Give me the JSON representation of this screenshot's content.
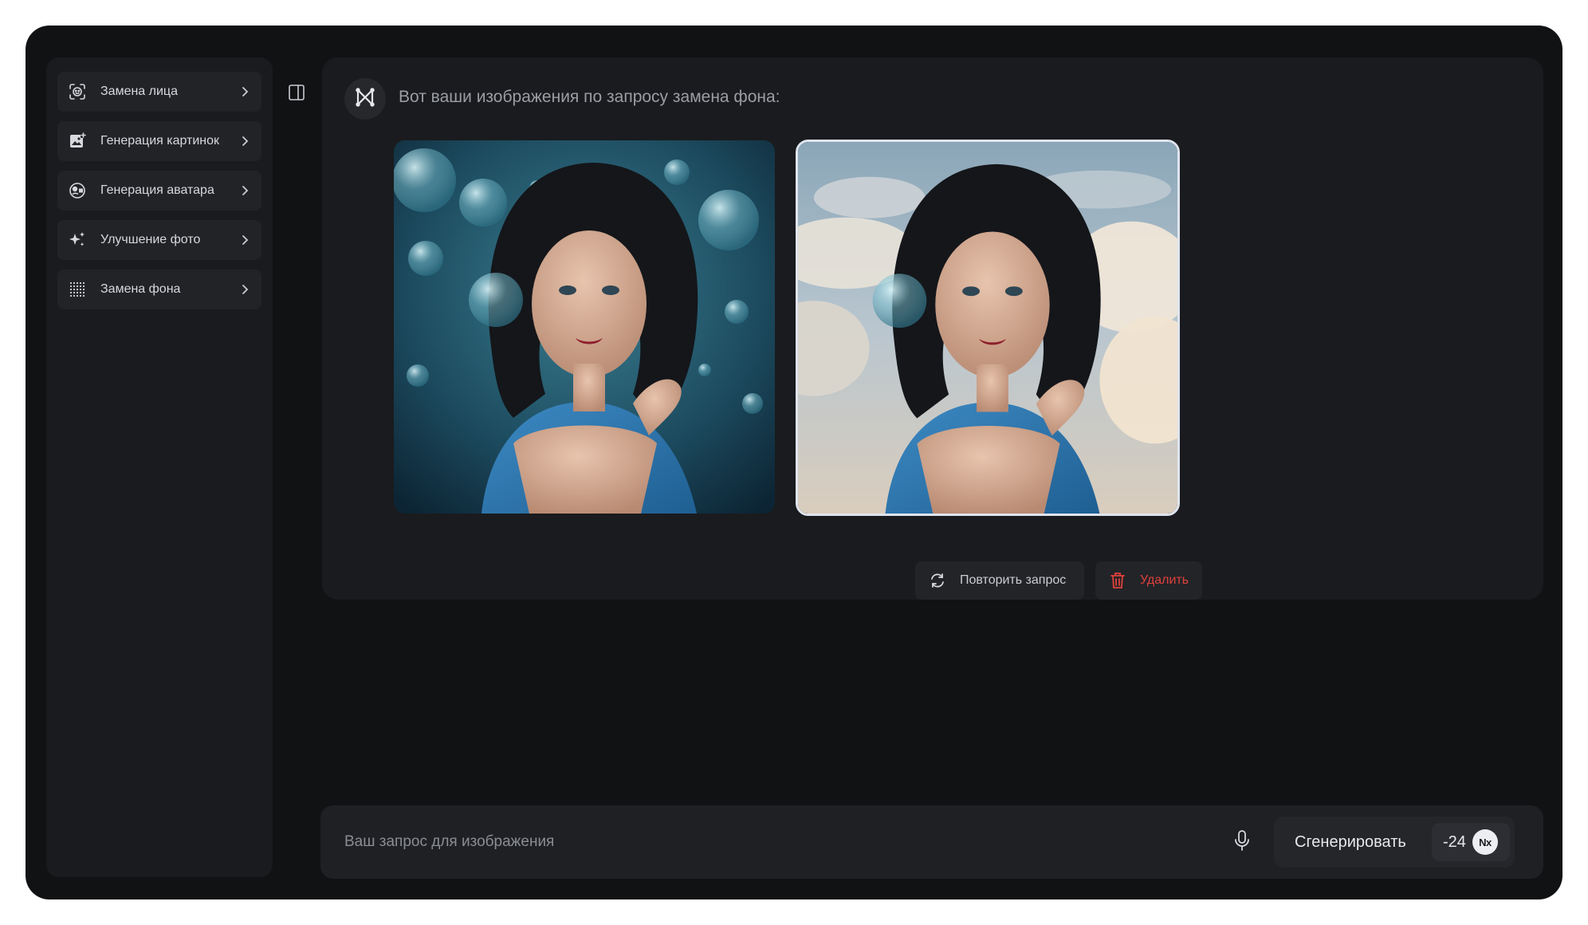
{
  "sidebar": {
    "items": [
      {
        "label": "Замена лица",
        "icon": "face-scan-icon"
      },
      {
        "label": "Генерация картинок",
        "icon": "image-add-icon"
      },
      {
        "label": "Генерация аватара",
        "icon": "avatar-icon"
      },
      {
        "label": "Улучшение фото",
        "icon": "sparkles-icon"
      },
      {
        "label": "Замена фона",
        "icon": "background-grid-icon"
      }
    ]
  },
  "chat": {
    "message": "Вот ваши изображения по запросу замена фона:",
    "images": [
      {
        "subject": "portrait-bubbles-background"
      },
      {
        "subject": "portrait-clouds-background",
        "selected": true
      }
    ],
    "actions": {
      "repeat_label": "Повторить запрос",
      "delete_label": "Удалить"
    }
  },
  "composer": {
    "placeholder": "Ваш запрос для изображения",
    "generate_label": "Сгенерировать",
    "cost": "-24",
    "coin_label": "Nx"
  },
  "colors": {
    "frame": "#111214",
    "panel": "#1a1b1e",
    "accent_delete": "#e0413b",
    "selected_border": "#dfe4ee"
  }
}
